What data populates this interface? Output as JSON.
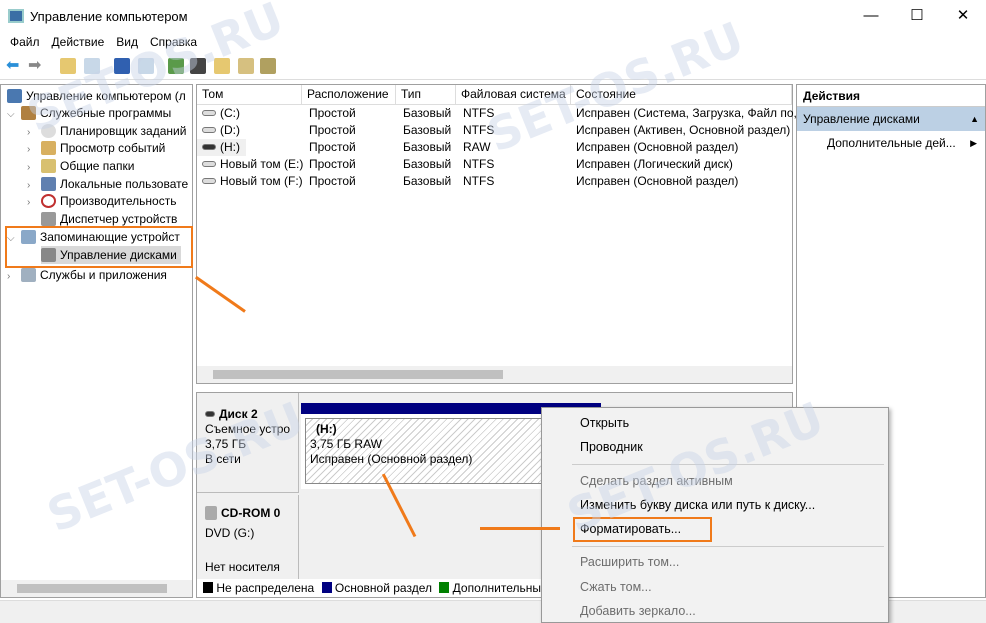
{
  "window": {
    "title": "Управление компьютером",
    "minimize": "—",
    "maximize": "☐",
    "close": "✕"
  },
  "menu": [
    "Файл",
    "Действие",
    "Вид",
    "Справка"
  ],
  "tree": {
    "root": "Управление компьютером (л",
    "utilities": "Служебные программы",
    "scheduler": "Планировщик заданий",
    "events": "Просмотр событий",
    "shared": "Общие папки",
    "users": "Локальные пользовате",
    "perf": "Производительность",
    "devmgr": "Диспетчер устройств",
    "storage": "Запоминающие устройст",
    "diskmgmt": "Управление дисками",
    "services": "Службы и приложения"
  },
  "list": {
    "headers": [
      "Том",
      "Расположение",
      "Тип",
      "Файловая система",
      "Состояние"
    ],
    "rows": [
      [
        "(C:)",
        "Простой",
        "Базовый",
        "NTFS",
        "Исправен (Система, Загрузка, Файл по,"
      ],
      [
        "(D:)",
        "Простой",
        "Базовый",
        "NTFS",
        "Исправен (Активен, Основной раздел)"
      ],
      [
        "(H:)",
        "Простой",
        "Базовый",
        "RAW",
        "Исправен (Основной раздел)"
      ],
      [
        "Новый том (E:)",
        "Простой",
        "Базовый",
        "NTFS",
        "Исправен (Логический диск)"
      ],
      [
        "Новый том (F:)",
        "Простой",
        "Базовый",
        "NTFS",
        "Исправен (Основной раздел)"
      ]
    ]
  },
  "disks": {
    "disk2": {
      "name": "Диск 2",
      "type": "Съемное устро",
      "size": "3,75 ГБ",
      "status": "В сети",
      "part_label": "(H:)",
      "part_size": "3,75 ГБ RAW",
      "part_status": "Исправен (Основной раздел)"
    },
    "cdrom": {
      "name": "CD-ROM 0",
      "type": "DVD (G:)",
      "status": "Нет носителя"
    }
  },
  "legend": [
    {
      "label": "Не распределена",
      "color": "#000000"
    },
    {
      "label": "Основной раздел",
      "color": "#000080"
    },
    {
      "label": "Дополнительны",
      "color": "#008000"
    }
  ],
  "actions": {
    "title": "Действия",
    "section": "Управление дисками",
    "more": "Дополнительные дей..."
  },
  "context": [
    "Открыть",
    "Проводник",
    "Сделать раздел активным",
    "Изменить букву диска или путь к диску...",
    "Форматировать...",
    "Расширить том...",
    "Сжать том...",
    "Добавить зеркало..."
  ],
  "watermark": "SET-OS.RU",
  "colors": {
    "accent": "#f07a1a",
    "primary": "#000080",
    "selected": "#cce8ff"
  }
}
